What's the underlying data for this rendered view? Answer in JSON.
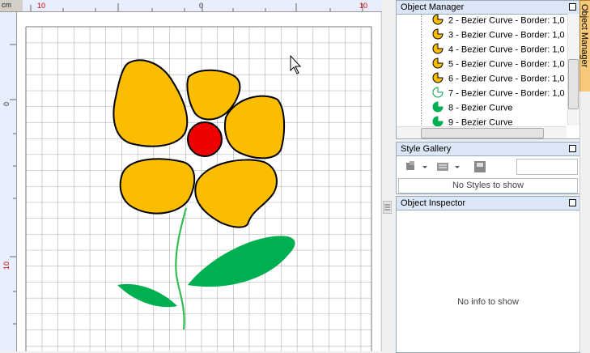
{
  "rulers": {
    "unit": "cm",
    "h_labels": [
      "10",
      "0",
      "10"
    ],
    "v_labels": [
      "0",
      "10"
    ]
  },
  "canvas": {
    "colors": {
      "petal": "#fbbd00",
      "center": "#ee0000",
      "leaf": "#00b050",
      "stem": "#33bb55",
      "grid": "#888888"
    }
  },
  "object_manager": {
    "title": "Object Manager",
    "items": [
      {
        "label": "2 - Bezier Curve - Border: 1,0",
        "icon": "bezier-orange-icon"
      },
      {
        "label": "3 - Bezier Curve - Border: 1,0",
        "icon": "bezier-orange-icon"
      },
      {
        "label": "4 - Bezier Curve - Border: 1,0",
        "icon": "bezier-orange-icon"
      },
      {
        "label": "5 - Bezier Curve - Border: 1,0",
        "icon": "bezier-orange-icon"
      },
      {
        "label": "6 - Bezier Curve - Border: 1,0",
        "icon": "bezier-orange-icon"
      },
      {
        "label": "7 - Bezier Curve - Border: 1,0",
        "icon": "bezier-outline-icon"
      },
      {
        "label": "8 - Bezier Curve",
        "icon": "bezier-green-icon"
      },
      {
        "label": "9 - Bezier Curve",
        "icon": "bezier-green-icon"
      }
    ]
  },
  "style_gallery": {
    "title": "Style Gallery",
    "empty_text": "No Styles to show"
  },
  "object_inspector": {
    "title": "Object Inspector",
    "empty_text": "No info to show"
  },
  "side_tab": {
    "label": "Object Manager"
  }
}
